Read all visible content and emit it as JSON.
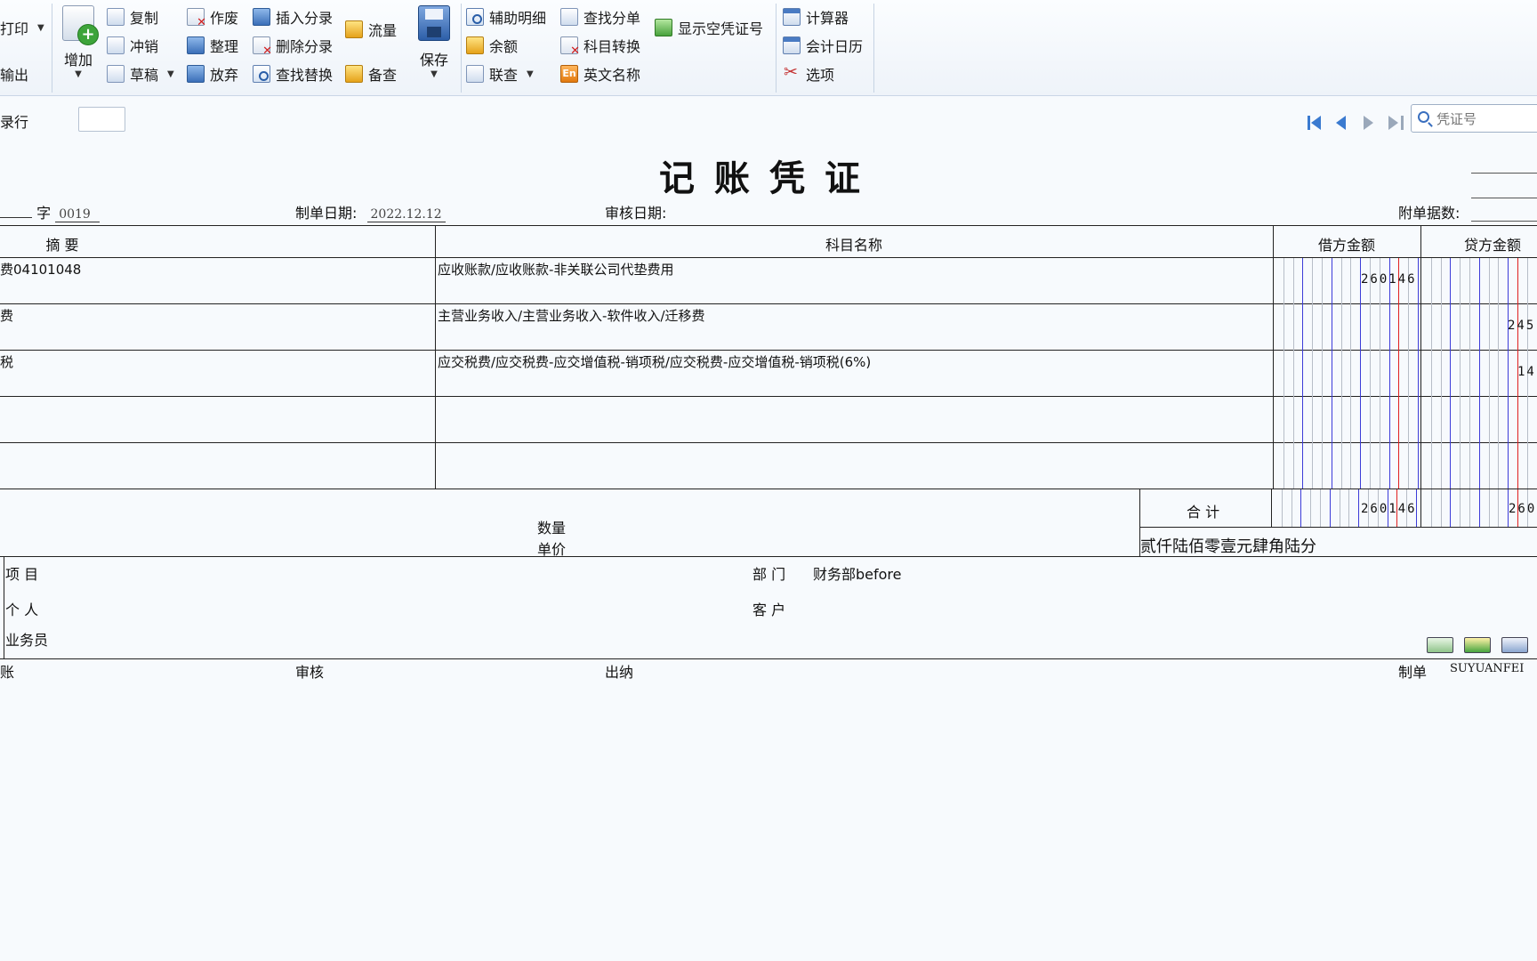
{
  "toolbar": {
    "print": "打印",
    "export": "输出",
    "add": "增加",
    "copy": "复制",
    "reverse": "冲销",
    "draft": "草稿",
    "void": "作废",
    "tidy": "整理",
    "discard": "放弃",
    "insert_entry": "插入分录",
    "delete_entry": "删除分录",
    "find_replace": "查找替换",
    "cash_flow": "流量",
    "backup_check": "备查",
    "save": "保存",
    "aux_detail": "辅助明细",
    "balance": "余额",
    "linked_query": "联查",
    "find_split": "查找分单",
    "account_convert": "科目转换",
    "english_name": "英文名称",
    "show_empty_voucher": "显示空凭证号",
    "calculator": "计算器",
    "accounting_calendar": "会计日历",
    "options": "选项"
  },
  "row2": {
    "record_row": "录行",
    "search_placeholder": "凭证号"
  },
  "voucher": {
    "title": "记账凭证",
    "word_label": "字",
    "voucher_no": "0019",
    "date_label": "制单日期:",
    "date_value": "2022.12.12",
    "audit_date_label": "审核日期:",
    "attachments_label": "附单据数:",
    "headers": {
      "summary": "摘 要",
      "account": "科目名称",
      "debit": "借方金额",
      "credit": "贷方金额"
    },
    "rows": [
      {
        "summary": "费04101048",
        "account": "应收账款/应收账款-非关联公司代垫费用",
        "debit": "260146",
        "credit": ""
      },
      {
        "summary": "费",
        "account": "主营业务收入/主营业务收入-软件收入/迁移费",
        "debit": "",
        "credit": "245"
      },
      {
        "summary": "税",
        "account": "应交税费/应交税费-应交增值税-销项税/应交税费-应交增值税-销项税(6%)",
        "debit": "",
        "credit": "14"
      },
      {
        "summary": "",
        "account": "",
        "debit": "",
        "credit": ""
      },
      {
        "summary": "",
        "account": "",
        "debit": "",
        "credit": ""
      }
    ],
    "quantity_label": "数量",
    "unit_price_label": "单价",
    "total_label": "合 计",
    "total_debit": "260146",
    "total_credit": "260",
    "amount_in_words": "贰仟陆佰零壹元肆角陆分",
    "project_label": "项 目",
    "department_label": "部 门",
    "department_value": "财务部before",
    "person_label": "个 人",
    "customer_label": "客 户",
    "salesman_label": "业务员",
    "bookkeep_label": "账",
    "audit_label": "审核",
    "cashier_label": "出纳",
    "maker_label": "制单",
    "maker_value": "SUYUANFEI"
  }
}
